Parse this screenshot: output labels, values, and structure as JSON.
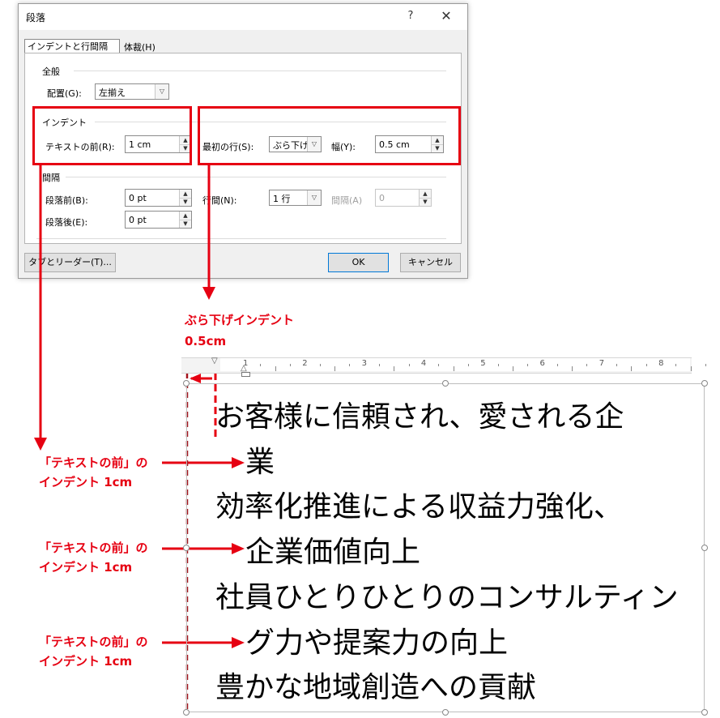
{
  "dialog": {
    "title": "段落",
    "help": "?",
    "close": "✕",
    "tabs": [
      {
        "label": "インデントと行間隔(I)"
      },
      {
        "label": "体裁(H)"
      }
    ],
    "general": {
      "heading": "全般",
      "alignment_label": "配置(G):",
      "alignment_value": "左揃え"
    },
    "indent": {
      "heading": "インデント",
      "before_text_label": "テキストの前(R):",
      "before_text_value": "1 cm",
      "special_label": "最初の行(S):",
      "special_value": "ぶら下げ",
      "by_label": "幅(Y):",
      "by_value": "0.5 cm"
    },
    "spacing": {
      "heading": "間隔",
      "before_label": "段落前(B):",
      "before_value": "0 pt",
      "after_label": "段落後(E):",
      "after_value": "0 pt",
      "line_label": "行間(N):",
      "line_value": "1 行",
      "at_label": "間隔(A)",
      "at_value": "0"
    },
    "buttons": {
      "tabs_leader": "タブとリーダー(T)...",
      "ok": "OK",
      "cancel": "キャンセル"
    }
  },
  "annotations": {
    "hanging": [
      "ぶら下げインデント",
      "0.5cm"
    ],
    "before_text": [
      "「テキストの前」の",
      "インデント 1cm"
    ]
  },
  "ruler": {
    "numbers": [
      "1",
      "2",
      "3",
      "4",
      "5",
      "6",
      "7",
      "8"
    ]
  },
  "document": {
    "lines": [
      "お客様に信頼され、愛される企",
      "業",
      "効率化推進による収益力強化、",
      "企業価値向上",
      "社員ひとりひとりのコンサルティン",
      "グ力や提案力の向上",
      "豊かな地域創造への貢献"
    ]
  },
  "colors": {
    "accent_red": "#e60012",
    "ok_border": "#0078d7"
  }
}
